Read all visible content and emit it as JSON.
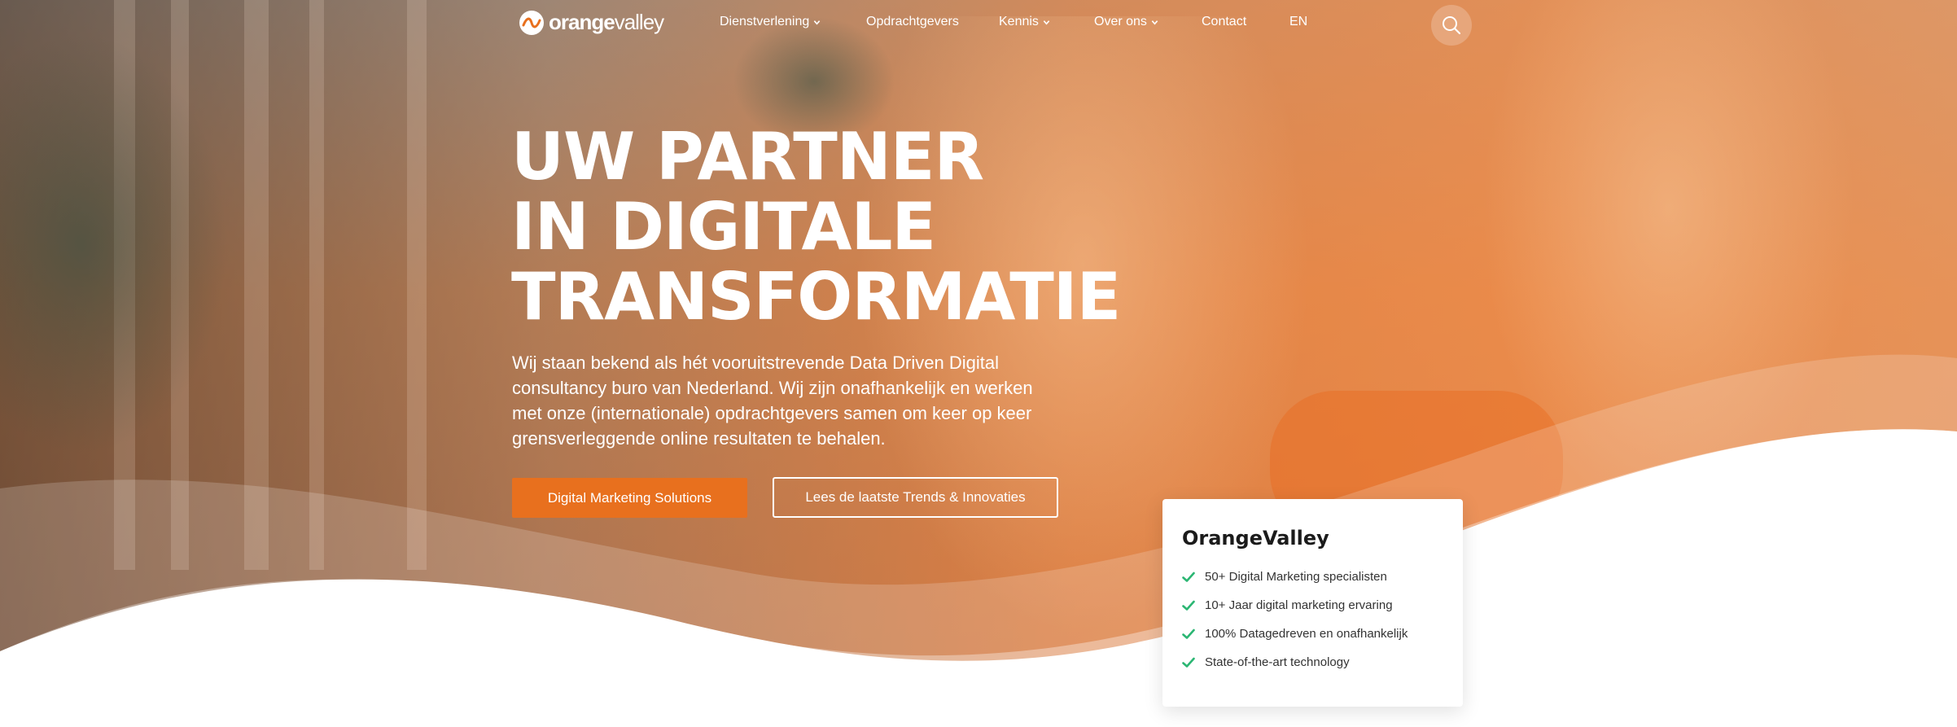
{
  "colors": {
    "accent": "#e8701e",
    "check": "#2bb673",
    "card_bg": "#ffffff"
  },
  "nav": {
    "logo_text_bold": "orange",
    "logo_text_light": "valley",
    "items": [
      {
        "label": "Dienstverlening",
        "has_dropdown": true,
        "icon": "chevron-down-icon"
      },
      {
        "label": "Opdrachtgevers",
        "has_dropdown": false
      },
      {
        "label": "Kennis",
        "has_dropdown": true,
        "icon": "chevron-down-icon"
      },
      {
        "label": "Over ons",
        "has_dropdown": true,
        "icon": "chevron-down-icon"
      },
      {
        "label": "Contact",
        "has_dropdown": false
      },
      {
        "label": "EN",
        "has_dropdown": false
      }
    ],
    "search_icon": "search-icon"
  },
  "hero": {
    "headline": [
      "UW PARTNER",
      "IN DIGITALE",
      "TRANSFORMATIE"
    ],
    "intro": "Wij staan bekend als hét vooruitstrevende Data Driven Digital consultancy buro van Nederland. Wij zijn onafhankelijk en werken met onze (internationale) opdrachtgevers samen om keer op keer grensverleggende online resultaten te behalen.",
    "primary_button": "Digital Marketing Solutions",
    "secondary_button": "Lees de laatste Trends & Innovaties"
  },
  "card": {
    "title": "OrangeValley",
    "items": [
      "50+ Digital Marketing specialisten",
      "10+ Jaar digital marketing ervaring",
      "100% Datagedreven en onafhankelijk",
      "State-of-the-art technology"
    ],
    "item_icon": "check-icon"
  }
}
